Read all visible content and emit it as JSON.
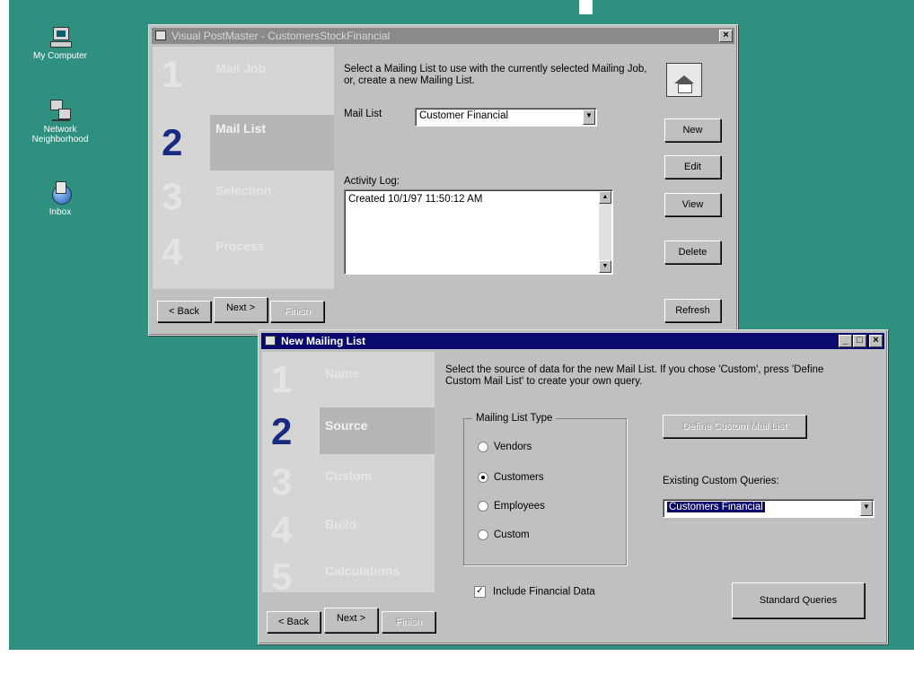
{
  "desktop": {
    "icons": [
      {
        "label": "My Computer",
        "icon": "computer-icon"
      },
      {
        "label": "Network Neighborhood",
        "icon": "network-icon"
      },
      {
        "label": "Inbox",
        "icon": "inbox-icon"
      }
    ]
  },
  "main_window": {
    "title": "Visual PostMaster - CustomersStockFinancial",
    "close_label": "×",
    "steps": [
      {
        "num": "1",
        "label": "Mail Job"
      },
      {
        "num": "2",
        "label": "Mail List",
        "current": true
      },
      {
        "num": "3",
        "label": "Selection"
      },
      {
        "num": "4",
        "label": "Process"
      }
    ],
    "instruction": "Select a Mailing List to use with the currently selected Mailing Job, or, create a new Mailing List.",
    "mail_list_label": "Mail List",
    "mail_list_value": "Customer Financial",
    "activity_log_label": "Activity Log:",
    "activity_log_text": "Created 10/1/97 11:50:12 AM",
    "buttons": {
      "new": "New",
      "edit": "Edit",
      "view": "View",
      "delete": "Delete",
      "refresh": "Refresh"
    },
    "nav": {
      "back": "< Back",
      "next": "Next >",
      "finish": "Finish"
    }
  },
  "dialog": {
    "title": "New Mailing List",
    "steps": [
      {
        "num": "1",
        "label": "Name"
      },
      {
        "num": "2",
        "label": "Source",
        "current": true
      },
      {
        "num": "3",
        "label": "Custom"
      },
      {
        "num": "4",
        "label": "Build"
      },
      {
        "num": "5",
        "label": "Calculations"
      }
    ],
    "instruction": "Select the source of data for the new Mail List. If you chose 'Custom', press 'Define Custom Mail List' to create your own query.",
    "group_label": "Mailing List Type",
    "radio_options": [
      "Vendors",
      "Customers",
      "Employees",
      "Custom"
    ],
    "selected_option": "Customers",
    "include_financial_label": "Include Financial Data",
    "include_financial_checked": true,
    "define_custom_label": "Define Custom Mail List",
    "existing_queries_label": "Existing Custom Queries:",
    "existing_queries_value": "Customers Financial",
    "standard_queries_label": "Standard Queries",
    "nav": {
      "back": "< Back",
      "next": "Next >",
      "finish": "Finish"
    }
  },
  "colors": {
    "desktop": "#2f9080",
    "active_title": "#0a0a6e",
    "step_number_current": "#1a2a80"
  }
}
